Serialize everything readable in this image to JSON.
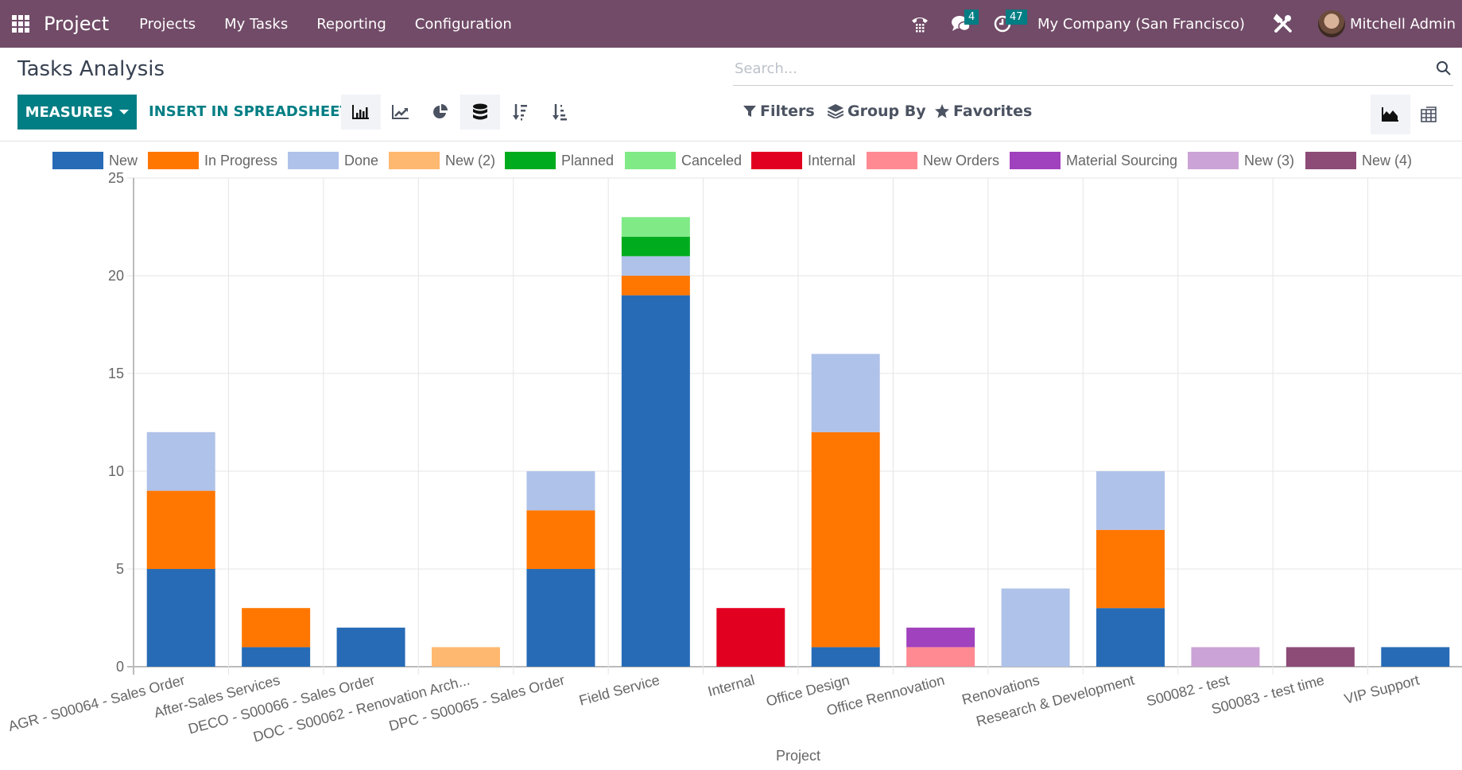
{
  "navbar": {
    "app_name": "Project",
    "menu": [
      "Projects",
      "My Tasks",
      "Reporting",
      "Configuration"
    ],
    "messages_count": "4",
    "activities_count": "47",
    "company": "My Company (San Francisco)",
    "user": "Mitchell Admin",
    "bg_color": "#714b67",
    "badge_color": "#017e84"
  },
  "page": {
    "title": "Tasks Analysis",
    "search_placeholder": "Search...",
    "measures_label": "MEASURES",
    "insert_label": "INSERT IN SPREADSHEET",
    "filters_label": "Filters",
    "groupby_label": "Group By",
    "favorites_label": "Favorites",
    "chart_tools": [
      "bar-chart-icon",
      "line-chart-icon",
      "pie-chart-icon",
      "stacked-icon",
      "sort-descending-icon",
      "sort-ascending-icon"
    ],
    "views": [
      "graph-view-icon",
      "pivot-view-icon"
    ],
    "accent_color": "#017e84"
  },
  "chart_data": {
    "type": "bar",
    "stacked": true,
    "title": "",
    "xlabel": "Project",
    "ylabel": "",
    "ylim": [
      0,
      25
    ],
    "yticks": [
      0,
      5,
      10,
      15,
      20,
      25
    ],
    "grid": true,
    "legend_position": "top",
    "categories": [
      "AGR - S00064 - Sales Order",
      "After-Sales Services",
      "DECO - S00066 - Sales Order",
      "DOC - S00062 - Renovation Arch...",
      "DPC - S00065 - Sales Order",
      "Field Service",
      "Internal",
      "Office Design",
      "Office Rennovation",
      "Renovations",
      "Research & Development",
      "S00082 - test",
      "S00083 - test time",
      "VIP Support"
    ],
    "series": [
      {
        "name": "New",
        "color": "#276bb6",
        "values": [
          5,
          1,
          2,
          0,
          5,
          19,
          0,
          1,
          0,
          0,
          3,
          0,
          0,
          1
        ]
      },
      {
        "name": "In Progress",
        "color": "#ff7701",
        "values": [
          4,
          2,
          0,
          0,
          3,
          1,
          0,
          11,
          0,
          0,
          4,
          0,
          0,
          0
        ]
      },
      {
        "name": "Done",
        "color": "#afc2e9",
        "values": [
          3,
          0,
          0,
          0,
          2,
          1,
          0,
          4,
          0,
          4,
          3,
          0,
          0,
          0
        ]
      },
      {
        "name": "New (2)",
        "color": "#ffb870",
        "values": [
          0,
          0,
          0,
          1,
          0,
          0,
          0,
          0,
          0,
          0,
          0,
          0,
          0,
          0
        ]
      },
      {
        "name": "Planned",
        "color": "#00ac1e",
        "values": [
          0,
          0,
          0,
          0,
          0,
          1,
          0,
          0,
          0,
          0,
          0,
          0,
          0,
          0
        ]
      },
      {
        "name": "Canceled",
        "color": "#80ea87",
        "values": [
          0,
          0,
          0,
          0,
          0,
          1,
          0,
          0,
          0,
          0,
          0,
          0,
          0,
          0
        ]
      },
      {
        "name": "Internal",
        "color": "#e20020",
        "values": [
          0,
          0,
          0,
          0,
          0,
          0,
          3,
          0,
          0,
          0,
          0,
          0,
          0,
          0
        ]
      },
      {
        "name": "New Orders",
        "color": "#ff8a92",
        "values": [
          0,
          0,
          0,
          0,
          0,
          0,
          0,
          0,
          1,
          0,
          0,
          0,
          0,
          0
        ]
      },
      {
        "name": "Material Sourcing",
        "color": "#a042bd",
        "values": [
          0,
          0,
          0,
          0,
          0,
          0,
          0,
          0,
          1,
          0,
          0,
          0,
          0,
          0
        ]
      },
      {
        "name": "New (3)",
        "color": "#cba3d6",
        "values": [
          0,
          0,
          0,
          0,
          0,
          0,
          0,
          0,
          0,
          0,
          0,
          1,
          0,
          0
        ]
      },
      {
        "name": "New (4)",
        "color": "#8d4b77",
        "values": [
          0,
          0,
          0,
          0,
          0,
          0,
          0,
          0,
          0,
          0,
          0,
          0,
          1,
          0
        ]
      }
    ]
  }
}
